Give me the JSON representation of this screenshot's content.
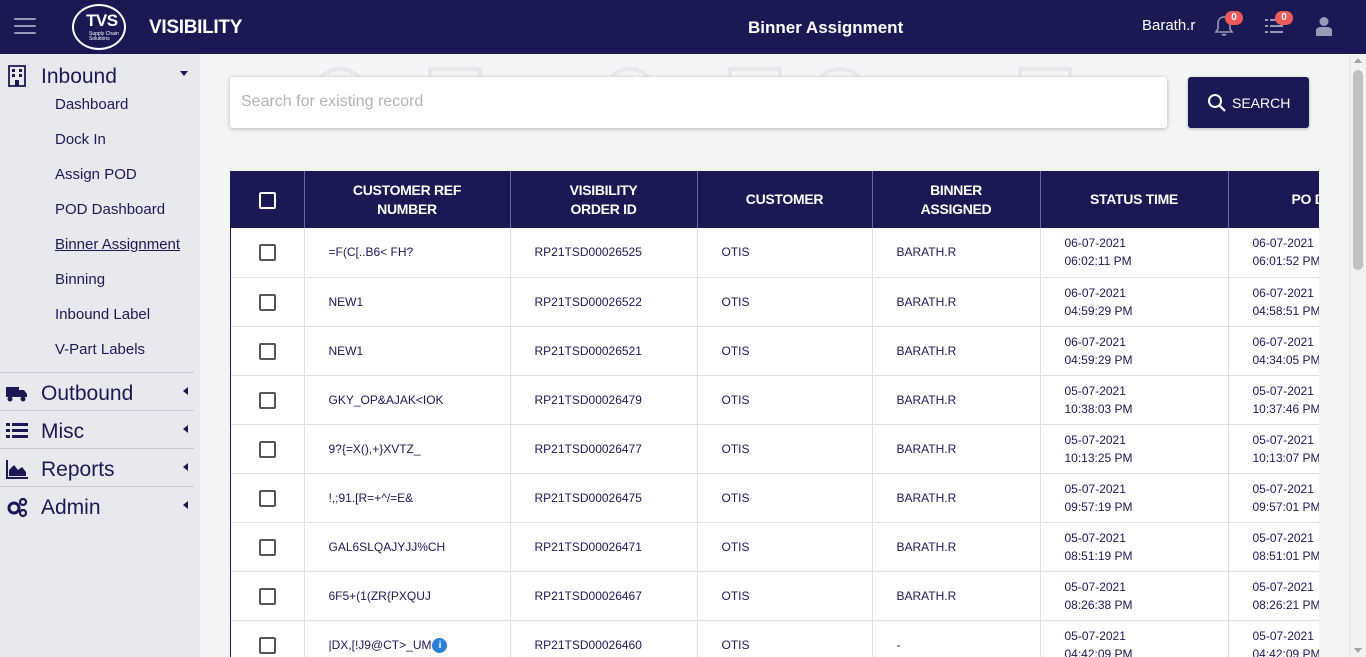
{
  "topbar": {
    "logo_text": "TVS",
    "logo_sub": "Supply Chain Solutions",
    "brand": "VISIBILITY",
    "page_title": "Binner Assignment",
    "user_name": "Barath.r",
    "notifications_count": "0",
    "tasks_count": "0"
  },
  "sidebar": {
    "inbound": {
      "label": "Inbound",
      "items": [
        "Dashboard",
        "Dock In",
        "Assign POD",
        "POD Dashboard",
        "Binner Assignment",
        "Binning",
        "Inbound Label",
        "V-Part Labels"
      ]
    },
    "outbound": {
      "label": "Outbound"
    },
    "misc": {
      "label": "Misc"
    },
    "reports": {
      "label": "Reports"
    },
    "admin": {
      "label": "Admin"
    }
  },
  "search": {
    "placeholder": "Search for existing record",
    "value": "",
    "button_label": "SEARCH"
  },
  "table": {
    "headers": {
      "customer_ref": "CUSTOMER REF NUMBER",
      "order_id": "VISIBILITY ORDER ID",
      "customer": "CUSTOMER",
      "binner": "BINNER ASSIGNED",
      "status_time": "STATUS TIME",
      "po_date": "PO DATE"
    },
    "rows": [
      {
        "ref": "=F(C[..B6< FH?",
        "order": "RP21TSD00026525",
        "customer": "OTIS",
        "binner": "BARATH.R",
        "st_date": "06-07-2021",
        "st_time": "06:02:11 PM",
        "po_date": "06-07-2021",
        "po_time": "06:01:52 PM"
      },
      {
        "ref": "NEW1",
        "order": "RP21TSD00026522",
        "customer": "OTIS",
        "binner": "BARATH.R",
        "st_date": "06-07-2021",
        "st_time": "04:59:29 PM",
        "po_date": "06-07-2021",
        "po_time": "04:58:51 PM"
      },
      {
        "ref": "NEW1",
        "order": "RP21TSD00026521",
        "customer": "OTIS",
        "binner": "BARATH.R",
        "st_date": "06-07-2021",
        "st_time": "04:59:29 PM",
        "po_date": "06-07-2021",
        "po_time": "04:34:05 PM"
      },
      {
        "ref": "GKY_OP&AJAK<IOK",
        "order": "RP21TSD00026479",
        "customer": "OTIS",
        "binner": "BARATH.R",
        "st_date": "05-07-2021",
        "st_time": "10:38:03 PM",
        "po_date": "05-07-2021",
        "po_time": "10:37:46 PM"
      },
      {
        "ref": "9?{=X(),+}XVTZ_",
        "order": "RP21TSD00026477",
        "customer": "OTIS",
        "binner": "BARATH.R",
        "st_date": "05-07-2021",
        "st_time": "10:13:25 PM",
        "po_date": "05-07-2021",
        "po_time": "10:13:07 PM"
      },
      {
        "ref": "!,;91.[R=+^/=E&",
        "order": "RP21TSD00026475",
        "customer": "OTIS",
        "binner": "BARATH.R",
        "st_date": "05-07-2021",
        "st_time": "09:57:19 PM",
        "po_date": "05-07-2021",
        "po_time": "09:57:01 PM"
      },
      {
        "ref": "GAL6SLQAJYJJ%CH",
        "order": "RP21TSD00026471",
        "customer": "OTIS",
        "binner": "BARATH.R",
        "st_date": "05-07-2021",
        "st_time": "08:51:19 PM",
        "po_date": "05-07-2021",
        "po_time": "08:51:01 PM"
      },
      {
        "ref": "6F5+(1(ZR{PXQUJ",
        "order": "RP21TSD00026467",
        "customer": "OTIS",
        "binner": "BARATH.R",
        "st_date": "05-07-2021",
        "st_time": "08:26:38 PM",
        "po_date": "05-07-2021",
        "po_time": "08:26:21 PM"
      },
      {
        "ref": "|DX,[!J9@CT>_UM",
        "order": "RP21TSD00026460",
        "customer": "OTIS",
        "binner": "-",
        "st_date": "05-07-2021",
        "st_time": "04:42:09 PM",
        "po_date": "05-07-2021",
        "po_time": "04:42:09 PM"
      }
    ]
  },
  "colors": {
    "primary": "#1c1853",
    "badge": "#ef5a5a",
    "info": "#2a80d9"
  }
}
